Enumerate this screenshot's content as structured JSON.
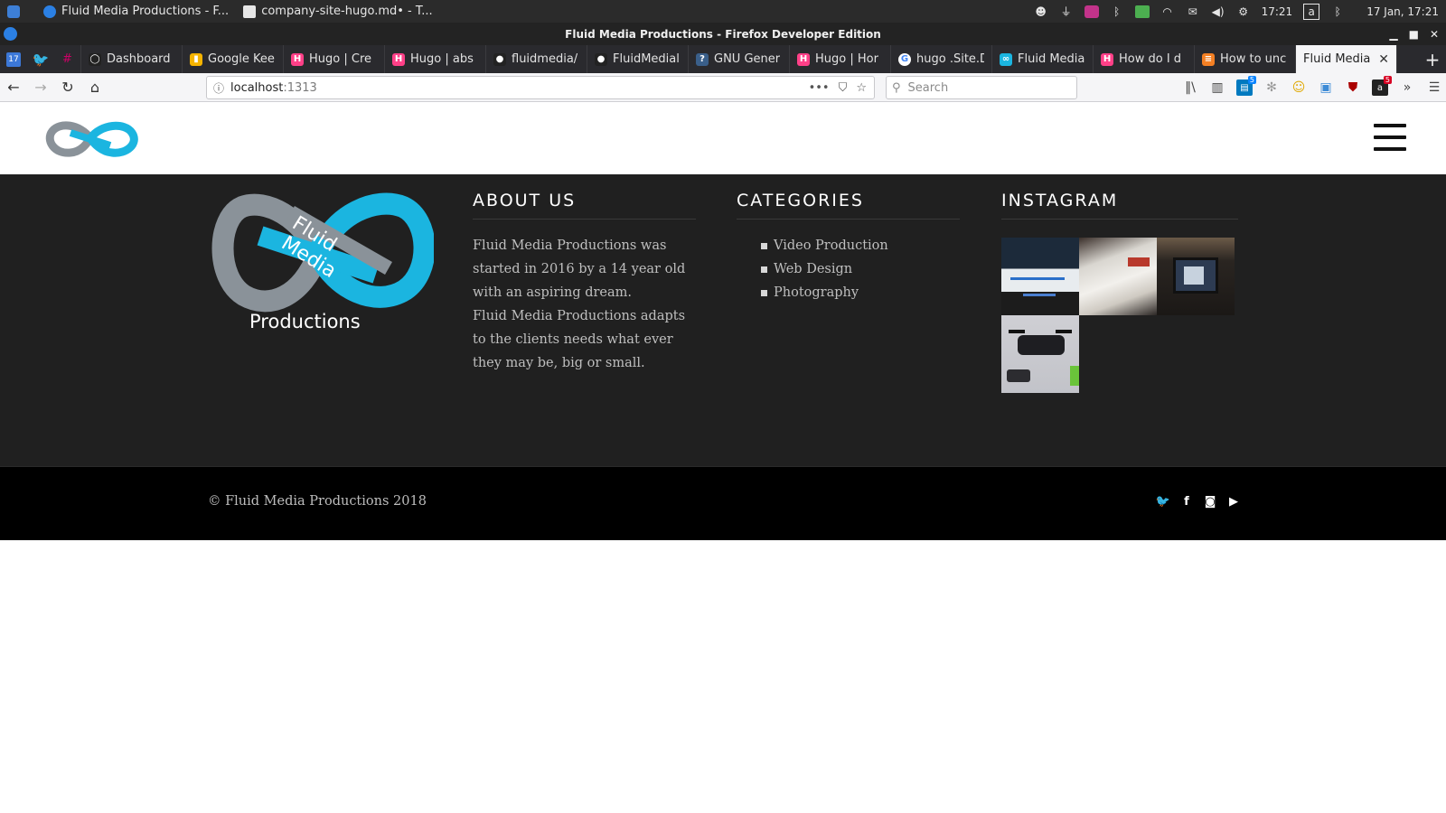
{
  "os_panel": {
    "tasks": [
      {
        "label": "Fluid Media Productions - F..."
      },
      {
        "label": "company-site-hugo.md• - T..."
      }
    ],
    "clock": "17:21",
    "date_time": "17 Jan, 17:21",
    "keyboard_indicator": "a"
  },
  "window": {
    "title": "Fluid Media Productions - Firefox Developer Edition"
  },
  "tabs": [
    {
      "label": "Dashboard",
      "icon": "github-icon",
      "color": "#222222",
      "glyph": "◯"
    },
    {
      "label": "Google Kee",
      "icon": "keep-icon",
      "color": "#f6b400",
      "glyph": "▮"
    },
    {
      "label": "Hugo | Cre",
      "icon": "hugo-icon",
      "color": "#ff4088",
      "glyph": "H"
    },
    {
      "label": "Hugo | abs",
      "icon": "hugo-icon",
      "color": "#ff4088",
      "glyph": "H"
    },
    {
      "label": "fluidmedia/",
      "icon": "github-icon",
      "color": "#222222",
      "glyph": "●"
    },
    {
      "label": "FluidMedial",
      "icon": "github-icon",
      "color": "#222222",
      "glyph": "●"
    },
    {
      "label": "GNU Gener",
      "icon": "gnu-icon",
      "color": "#3a5f8a",
      "glyph": "?"
    },
    {
      "label": "Hugo | Hor",
      "icon": "hugo-icon",
      "color": "#ff4088",
      "glyph": "H"
    },
    {
      "label": "hugo .Site.D",
      "icon": "google-icon",
      "color": "#ffffff",
      "glyph": "G"
    },
    {
      "label": "Fluid Media",
      "icon": "fluid-media-icon",
      "color": "#1bb5e0",
      "glyph": "∞"
    },
    {
      "label": "How do I d",
      "icon": "hugo-icon",
      "color": "#ff4088",
      "glyph": "H"
    },
    {
      "label": "How to unc",
      "icon": "stackoverflow-icon",
      "color": "#f48024",
      "glyph": "≡"
    }
  ],
  "active_tab": {
    "label": "Fluid Media"
  },
  "nav": {
    "url_host": "localhost",
    "url_port": ":1313",
    "search_placeholder": "Search"
  },
  "toolbar_badges": {
    "pocket_count": "5",
    "ext_count": "5"
  },
  "site": {
    "about": {
      "heading": "ABOUT US",
      "paragraph_1": "Fluid Media Productions was started in 2016 by a 14 year old with an aspiring dream.",
      "paragraph_2": "Fluid Media Productions adapts to the clients needs what ever they may be, big or small."
    },
    "categories": {
      "heading": "CATEGORIES",
      "items": [
        "Video Production",
        "Web Design",
        "Photography"
      ]
    },
    "instagram": {
      "heading": "INSTAGRAM"
    },
    "logo_text": {
      "line1": "Fluid",
      "line2": "Media",
      "line3": "Productions"
    },
    "copyright": "© Fluid Media Productions 2018"
  },
  "colors": {
    "brand_blue": "#1bb5e0",
    "brand_grey": "#8a9299",
    "footer_bg": "#202020",
    "bottom_bar_bg": "#000000"
  }
}
